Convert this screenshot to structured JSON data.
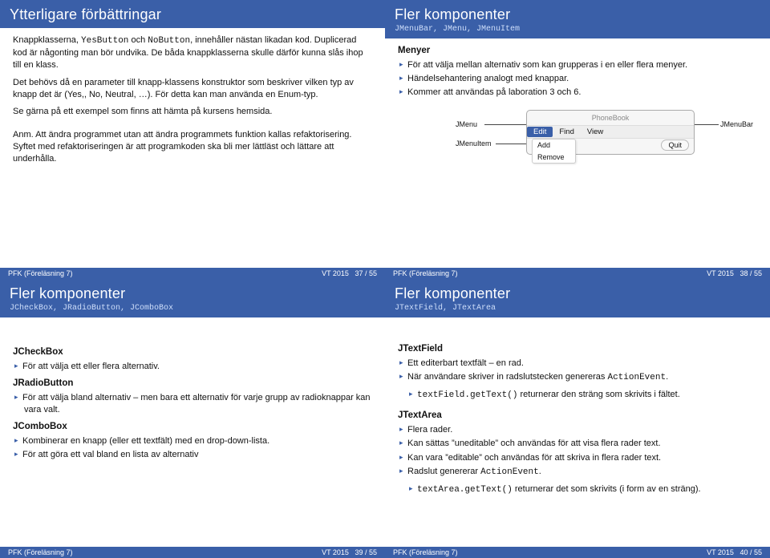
{
  "slides": {
    "s1": {
      "title": "Ytterligare förbättringar",
      "p1a": "Knappklasserna, ",
      "p1b": " och ",
      "p1c": ", innehåller nästan likadan kod. Duplicerad kod är någonting man bör undvika. De båda knappklasserna skulle därför kunna slås ihop till en klass.",
      "yes": "YesButton",
      "no": "NoButton",
      "p2": "Det behövs då en parameter till knapp-klassens konstruktor som beskriver vilken typ av knapp det är (Yes,, No, Neutral, …). För detta kan man använda en Enum-typ.",
      "p3": "Se gärna på ett exempel som finns att hämta på kursens hemsida.",
      "p4": "Anm. Att ändra programmet utan att ändra programmets funktion kallas refaktorisering. Syftet med refaktoriseringen är att programkoden ska bli mer lättläst och lättare att underhålla.",
      "page": "37 / 55"
    },
    "s2": {
      "title": "Fler komponenter",
      "sub": "JMenuBar, JMenu, JMenuItem",
      "menyer": "Menyer",
      "b1": "För att välja mellan alternativ som kan grupperas i en eller flera menyer.",
      "b2": "Händelsehantering analogt med knappar.",
      "b3": "Kommer att användas på laboration 3 och 6.",
      "jmenu": "JMenu",
      "jmenuitem": "JMenuItem",
      "jmenubar": "JMenuBar",
      "wintitle": "PhoneBook",
      "mi_edit": "Edit",
      "mi_find": "Find",
      "mi_view": "View",
      "dd_add": "Add",
      "dd_remove": "Remove",
      "quit": "Quit",
      "page": "38 / 55"
    },
    "s3": {
      "title": "Fler komponenter",
      "sub": "JCheckBox, JRadioButton, JComboBox",
      "h1": "JCheckBox",
      "h1b": "För att välja ett eller flera alternativ.",
      "h2": "JRadioButton",
      "h2b": "För att välja bland alternativ – men bara ett alternativ för varje grupp av radioknappar kan vara valt.",
      "h3": "JComboBox",
      "h3b1": "Kombinerar en knapp (eller ett textfält) med en drop-down-lista.",
      "h3b2": "För att göra ett val bland en lista av alternativ",
      "page": "39 / 55"
    },
    "s4": {
      "title": "Fler komponenter",
      "sub": "JTextField, JTextArea",
      "h1": "JTextField",
      "h1b1": "Ett editerbart textfält – en rad.",
      "h1b2a": "När användare skriver in radslutstecken genereras ",
      "h1b2b": ".",
      "ae": "ActionEvent",
      "h1b3a": " returnerar den sträng som skrivits i fältet.",
      "tfget": "textField.getText()",
      "h2": "JTextArea",
      "h2b1": "Flera rader.",
      "h2b2": "Kan sättas ”uneditable” och användas för att visa flera rader text.",
      "h2b3": "Kan vara ”editable” och användas för att skriva in flera rader text.",
      "h2b4a": "Radslut genererar ",
      "h2b4b": ".",
      "h2b5a": " returnerar det som skrivits (i form av en sträng).",
      "taget": "textArea.getText()",
      "page": "40 / 55"
    },
    "foot": {
      "left": "PFK (Föreläsning 7)",
      "center": "",
      "right_prefix": "VT 2015"
    }
  }
}
